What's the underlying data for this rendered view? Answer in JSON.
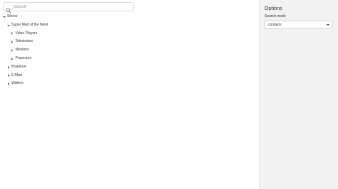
{
  "search": {
    "placeholder": "Search",
    "value": ""
  },
  "tree": {
    "stores": {
      "label": "Stores",
      "super_mart": {
        "label": "Super Mart of the West",
        "children": [
          "Video Players",
          "Televisions",
          "Monitors",
          "Projectors"
        ]
      },
      "others": [
        "Braeburn",
        "E-Mart",
        "Walters"
      ]
    }
  },
  "options": {
    "title": "Options",
    "search_mode_label": "Search mode",
    "search_mode_value": "contains"
  },
  "icons": {
    "search": "search-icon",
    "expanded": "triangle-down-icon",
    "collapsed": "triangle-right-icon",
    "dropdown": "chevron-down-icon"
  },
  "colors": {
    "panel_bg": "#f2f2f2",
    "text": "#333333",
    "border": "#dddddd"
  }
}
